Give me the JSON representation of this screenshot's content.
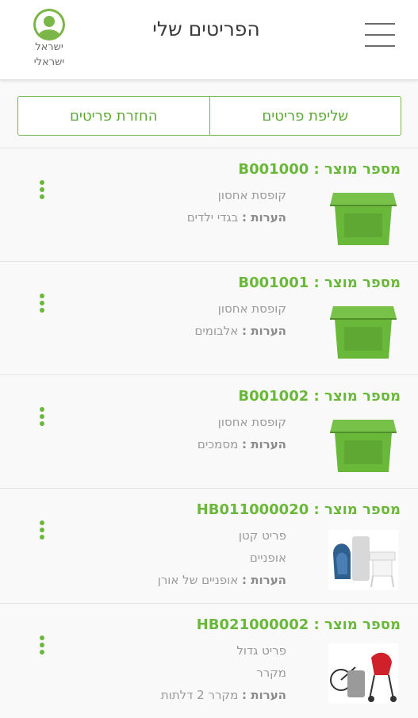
{
  "header": {
    "title": "הפריטים שלי",
    "user_first": "ישראל",
    "user_last": "ישראלי"
  },
  "tabs": [
    {
      "label": "שליפת פריטים"
    },
    {
      "label": "החזרת פריטים"
    }
  ],
  "item_label": "מספר מוצר :",
  "notes_label": "הערות :",
  "items": [
    {
      "product_no": "B001000",
      "type": "קופסת אחסון",
      "category": "",
      "notes": "בגדי ילדים",
      "image": "storage-box"
    },
    {
      "product_no": "B001001",
      "type": "קופסת אחסון",
      "category": "",
      "notes": "אלבומים",
      "image": "storage-box"
    },
    {
      "product_no": "B001002",
      "type": "קופסת אחסון",
      "category": "",
      "notes": "מסמכים",
      "image": "storage-box"
    },
    {
      "product_no": "HB011000020",
      "type": "פריט קטן",
      "category": "אופניים",
      "notes": "אופניים של אורן",
      "image": "small-items"
    },
    {
      "product_no": "HB021000002",
      "type": "פריט גדול",
      "category": "מקרר",
      "notes": "מקרר 2 דלתות",
      "image": "large-items"
    }
  ],
  "colors": {
    "accent": "#6ab83a",
    "border": "#7ab648"
  }
}
